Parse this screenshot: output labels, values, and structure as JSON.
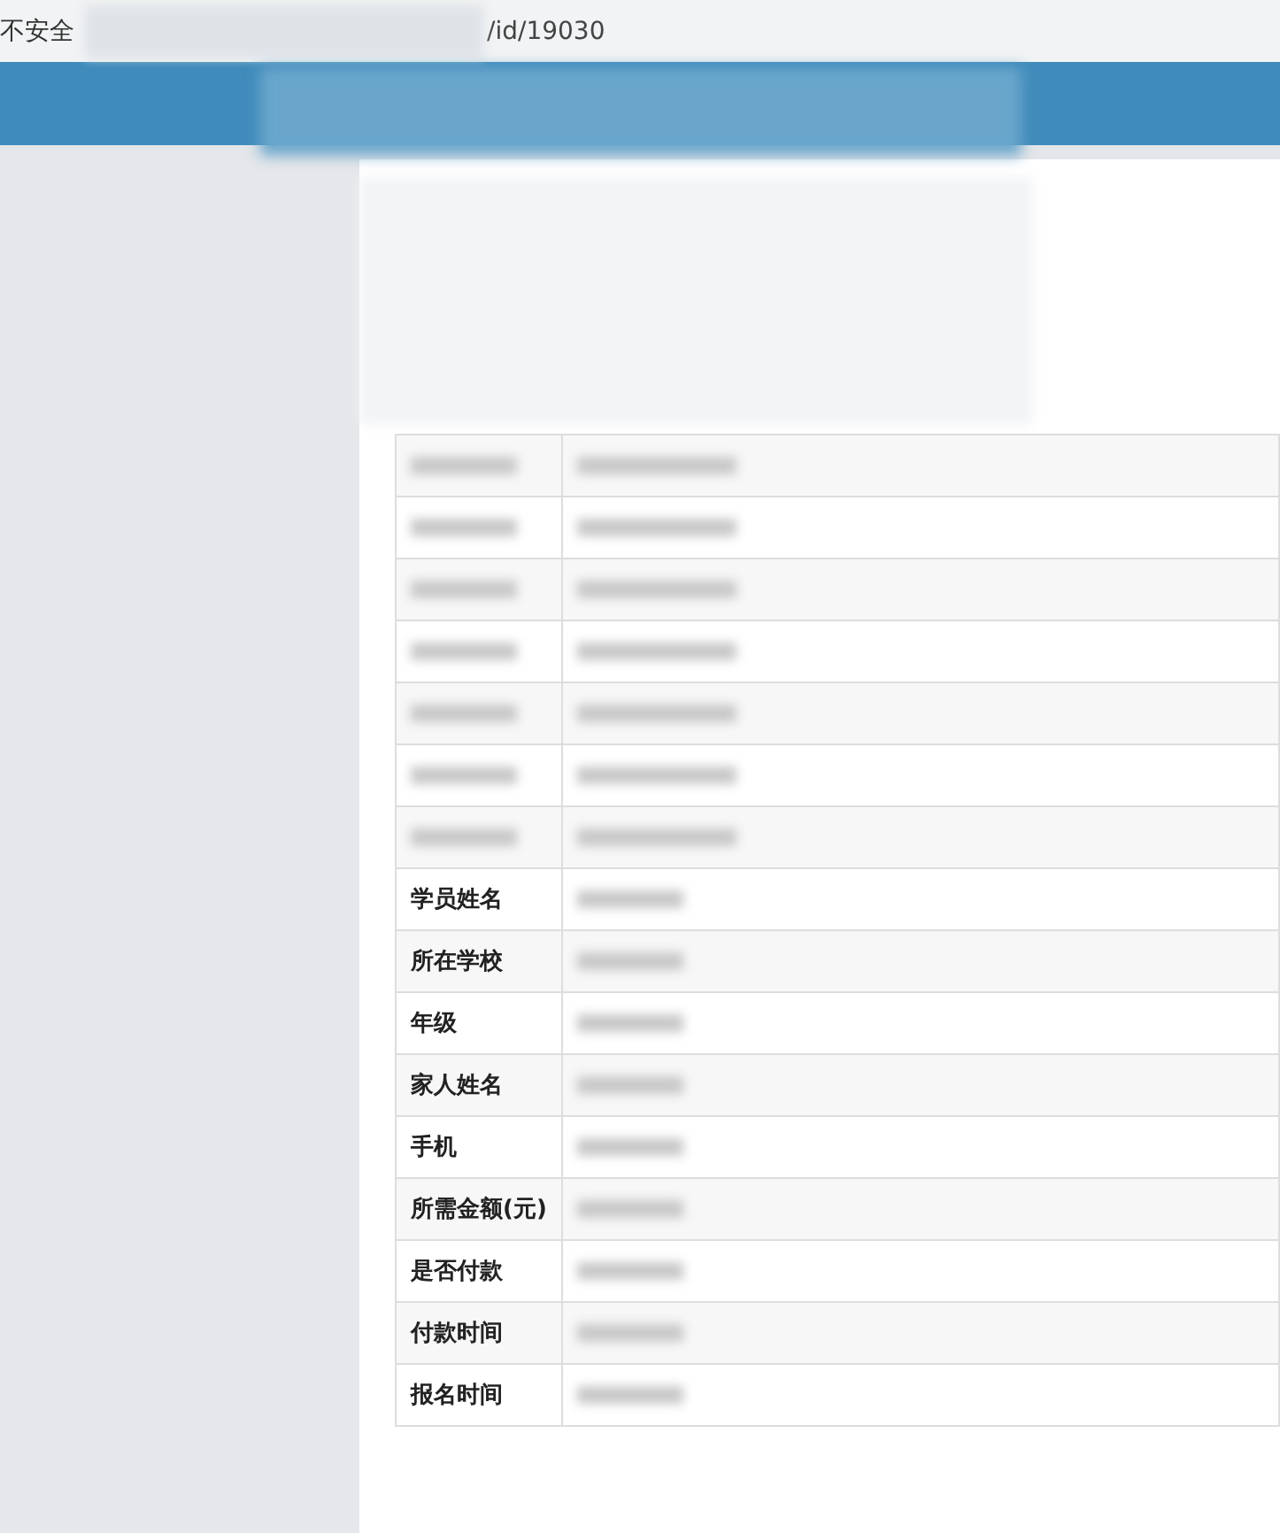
{
  "address_bar": {
    "security_label": "不安全",
    "url_tail": "/id/19030"
  },
  "table": {
    "rows": [
      {
        "kind": "redacted"
      },
      {
        "kind": "redacted"
      },
      {
        "kind": "redacted"
      },
      {
        "kind": "redacted"
      },
      {
        "kind": "redacted"
      },
      {
        "kind": "redacted"
      },
      {
        "kind": "redacted"
      },
      {
        "kind": "field",
        "label": "学员姓名"
      },
      {
        "kind": "field",
        "label": "所在学校"
      },
      {
        "kind": "field",
        "label": "年级"
      },
      {
        "kind": "field",
        "label": "家人姓名"
      },
      {
        "kind": "field",
        "label": "手机"
      },
      {
        "kind": "field",
        "label": "所需金额(元)"
      },
      {
        "kind": "field",
        "label": "是否付款"
      },
      {
        "kind": "field",
        "label": "付款时间"
      },
      {
        "kind": "field",
        "label": "报名时间"
      }
    ]
  }
}
